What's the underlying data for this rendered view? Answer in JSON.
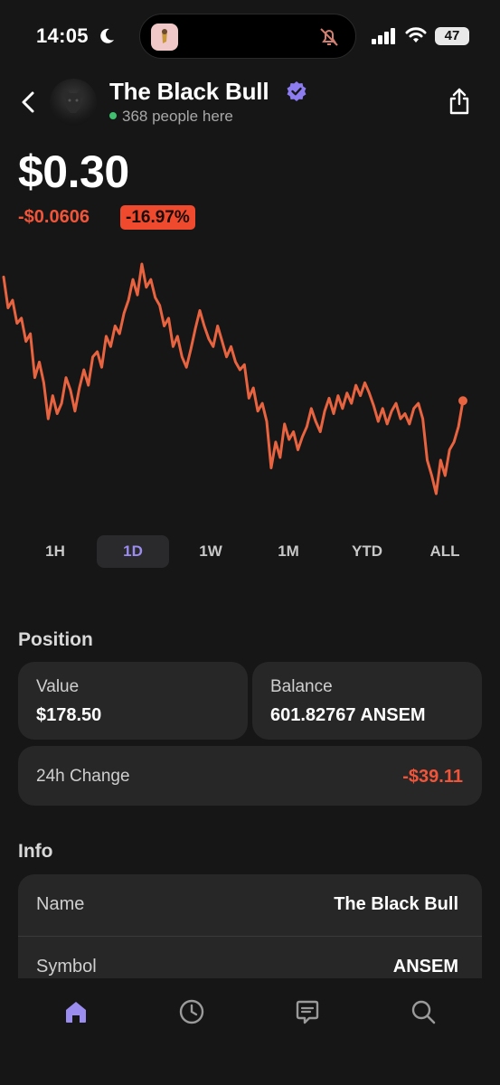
{
  "status_bar": {
    "time": "14:05",
    "battery": "47",
    "icons": [
      "moon-icon",
      "app-icon",
      "bell-slash-icon",
      "signal-icon",
      "wifi-icon",
      "battery-icon"
    ]
  },
  "header": {
    "title": "The Black Bull",
    "online_text": "368 people here",
    "icons": [
      "back-chevron-icon",
      "verified-badge-icon",
      "share-icon"
    ]
  },
  "price": {
    "value": "$0.30",
    "change_abs": "-$0.0606",
    "change_pct": "-16.97%"
  },
  "chart_data": {
    "type": "line",
    "color": "#e8633f",
    "values": [
      0.335,
      0.323,
      0.326,
      0.317,
      0.319,
      0.31,
      0.313,
      0.296,
      0.302,
      0.294,
      0.28,
      0.289,
      0.282,
      0.286,
      0.296,
      0.291,
      0.283,
      0.292,
      0.299,
      0.293,
      0.304,
      0.306,
      0.3,
      0.312,
      0.308,
      0.316,
      0.313,
      0.321,
      0.326,
      0.334,
      0.328,
      0.34,
      0.331,
      0.334,
      0.327,
      0.324,
      0.316,
      0.319,
      0.308,
      0.312,
      0.304,
      0.3,
      0.307,
      0.315,
      0.322,
      0.316,
      0.311,
      0.308,
      0.316,
      0.31,
      0.304,
      0.308,
      0.302,
      0.299,
      0.301,
      0.288,
      0.292,
      0.283,
      0.286,
      0.279,
      0.261,
      0.271,
      0.265,
      0.278,
      0.272,
      0.275,
      0.268,
      0.273,
      0.277,
      0.284,
      0.279,
      0.275,
      0.283,
      0.288,
      0.282,
      0.289,
      0.284,
      0.29,
      0.286,
      0.293,
      0.289,
      0.294,
      0.29,
      0.285,
      0.279,
      0.284,
      0.278,
      0.283,
      0.286,
      0.28,
      0.282,
      0.278,
      0.284,
      0.286,
      0.28,
      0.264,
      0.258,
      0.251,
      0.264,
      0.258,
      0.268,
      0.271,
      0.277,
      0.287
    ]
  },
  "range_tabs": [
    "1H",
    "1D",
    "1W",
    "1M",
    "YTD",
    "ALL"
  ],
  "selected_range": "1D",
  "position": {
    "heading": "Position",
    "value_label": "Value",
    "value": "$178.50",
    "balance_label": "Balance",
    "balance": "601.82767 ANSEM",
    "change_label": "24h Change",
    "change": "-$39.11"
  },
  "info": {
    "heading": "Info",
    "rows": [
      {
        "label": "Name",
        "value": "The Black Bull"
      },
      {
        "label": "Symbol",
        "value": "ANSEM"
      }
    ]
  },
  "bottom_nav": {
    "active": "home",
    "items": [
      "home-icon",
      "clock-icon",
      "chat-icon",
      "search-icon"
    ]
  },
  "colors": {
    "background": "#161616",
    "card": "#272727",
    "accent": "#9b8cf0",
    "negative": "#ef4a2e",
    "online": "#3fbf6f"
  }
}
